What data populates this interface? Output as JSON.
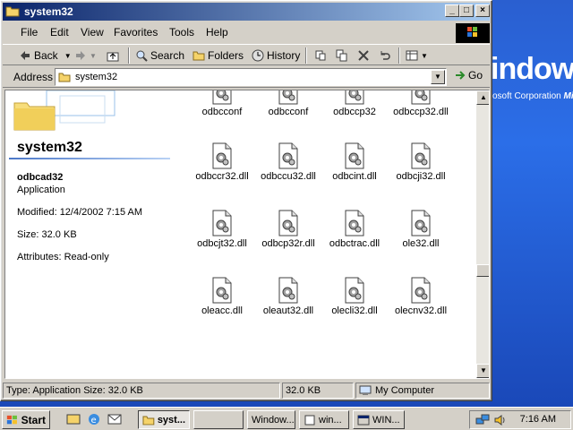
{
  "desktop": {
    "brand_text": "indows",
    "corp_text": "osoft Corporation",
    "corp_tail": "Mic"
  },
  "window": {
    "title": "system32",
    "menu": [
      "File",
      "Edit",
      "View",
      "Favorites",
      "Tools",
      "Help"
    ],
    "toolbar": {
      "back": "Back",
      "search": "Search",
      "folders": "Folders",
      "history": "History"
    },
    "address": {
      "label": "Address",
      "value": "system32",
      "go": "Go"
    }
  },
  "webview": {
    "folder_title": "system32",
    "selected_name": "odbcad32",
    "selected_type": "Application",
    "modified": "Modified: 12/4/2002 7:15 AM",
    "size": "Size: 32.0 KB",
    "attributes": "Attributes: Read-only"
  },
  "files": [
    "odbcconf",
    "odbcconf",
    "odbccp32",
    "odbccp32.dll",
    "odbccr32.dll",
    "odbccu32.dll",
    "odbcint.dll",
    "odbcji32.dll",
    "odbcjt32.dll",
    "odbcp32r.dll",
    "odbctrac.dll",
    "ole32.dll",
    "oleacc.dll",
    "oleaut32.dll",
    "olecli32.dll",
    "olecnv32.dll"
  ],
  "statusbar": {
    "left": "Type: Application Size: 32.0 KB",
    "size": "32.0 KB",
    "zone": "My Computer"
  },
  "taskbar": {
    "start": "Start",
    "tasks": [
      "syst...",
      "",
      "Window...",
      "win...",
      "WIN..."
    ],
    "clock": "7:16 AM"
  },
  "colors": {
    "title_start": "#0a246a",
    "title_end": "#a6caf0",
    "face": "#d4d0c8",
    "desktop": "#2b6ee8"
  }
}
